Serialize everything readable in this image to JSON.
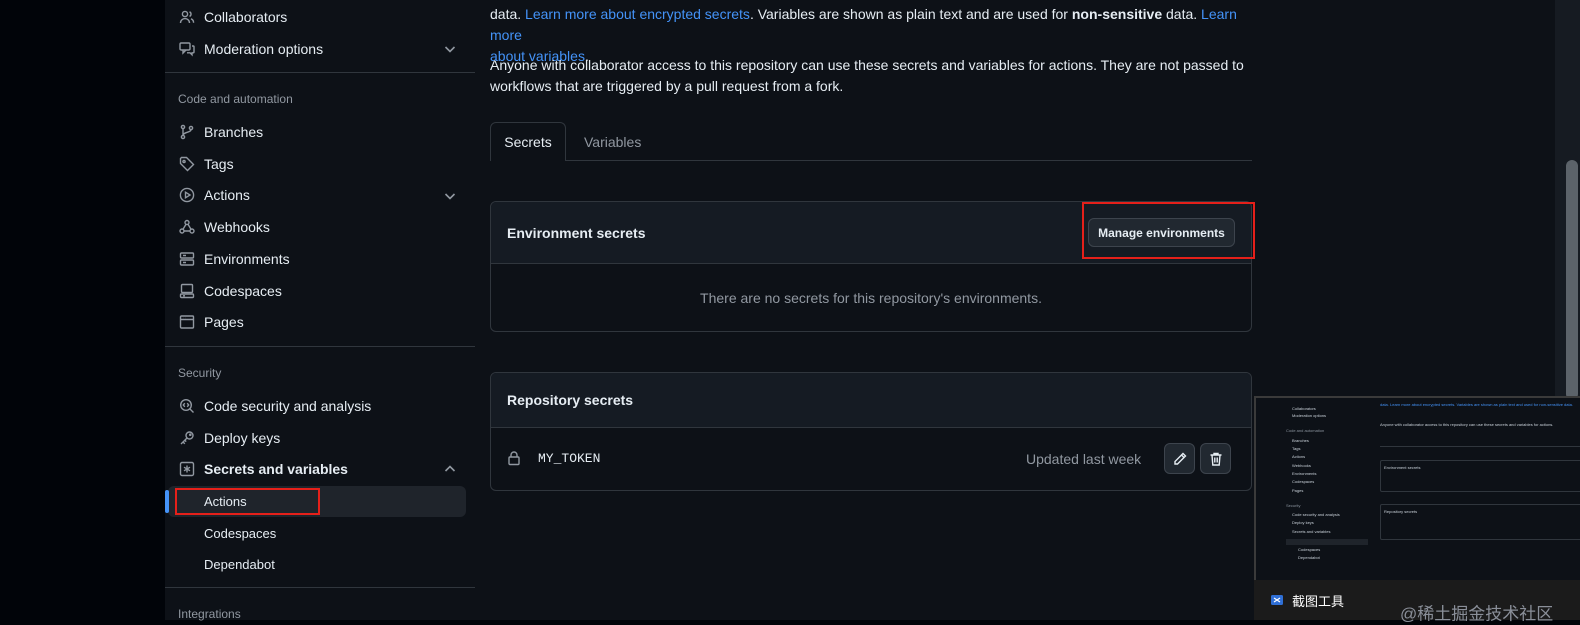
{
  "sidebar": {
    "top_items": [
      {
        "label": "Collaborators",
        "icon": "people-icon"
      },
      {
        "label": "Moderation options",
        "icon": "comment-discussion-icon"
      }
    ],
    "code_section": "Code and automation",
    "code_items": [
      {
        "label": "Branches",
        "icon": "git-branch-icon"
      },
      {
        "label": "Tags",
        "icon": "tag-icon"
      },
      {
        "label": "Actions",
        "icon": "play-icon"
      },
      {
        "label": "Webhooks",
        "icon": "webhook-icon"
      },
      {
        "label": "Environments",
        "icon": "server-icon"
      },
      {
        "label": "Codespaces",
        "icon": "codespaces-icon"
      },
      {
        "label": "Pages",
        "icon": "browser-icon"
      }
    ],
    "security_section": "Security",
    "security_items": [
      {
        "label": "Code security and analysis",
        "icon": "codescan-icon"
      },
      {
        "label": "Deploy keys",
        "icon": "key-icon"
      },
      {
        "label": "Secrets and variables",
        "icon": "asterisk-icon"
      }
    ],
    "sub_items": [
      "Actions",
      "Codespaces",
      "Dependabot"
    ],
    "integrations_section": "Integrations"
  },
  "intro": {
    "p1_a": "data. ",
    "p1_link1": "Learn more about encrypted secrets",
    "p1_b": ". Variables are shown as plain text and are used for ",
    "p1_bold": "non-sensitive",
    "p1_c": " data. ",
    "p1_link2_line1": "Learn more",
    "p1_link2_line2": "about variables",
    "p1_d": ".",
    "p2_line1": "Anyone with collaborator access to this repository can use these secrets and variables for actions. They are not passed to",
    "p2_line2": "workflows that are triggered by a pull request from a fork."
  },
  "tabs": [
    "Secrets",
    "Variables"
  ],
  "env_secrets": {
    "title": "Environment secrets",
    "button": "Manage environments",
    "empty": "There are no secrets for this repository's environments."
  },
  "repo_secrets": {
    "title": "Repository secrets",
    "rows": [
      {
        "name": "MY_TOKEN",
        "updated": "Updated last week"
      }
    ]
  },
  "taskbar": {
    "title": "截图工具"
  },
  "watermark": "@稀土掘金技术社区",
  "colors": {
    "accent": "#4493f8",
    "highlight_box": "#e5201a",
    "background": "#0d1117"
  }
}
